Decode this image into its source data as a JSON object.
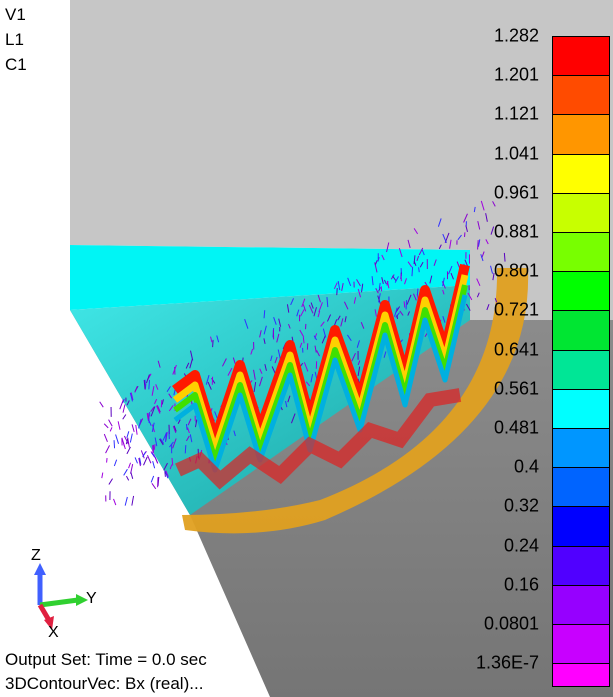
{
  "view_labels": [
    "V1",
    "L1",
    "C1"
  ],
  "legend": {
    "entries": [
      {
        "label": "1.282",
        "color": "#ff0000"
      },
      {
        "label": "1.201",
        "color": "#ff4b00"
      },
      {
        "label": "1.121",
        "color": "#ff9600"
      },
      {
        "label": "1.041",
        "color": "#ffff00"
      },
      {
        "label": "0.961",
        "color": "#c8ff00"
      },
      {
        "label": "0.881",
        "color": "#78ff00"
      },
      {
        "label": "0.801",
        "color": "#00ff00"
      },
      {
        "label": "0.721",
        "color": "#00e632"
      },
      {
        "label": "0.641",
        "color": "#00e696"
      },
      {
        "label": "0.561",
        "color": "#00ffff"
      },
      {
        "label": "0.481",
        "color": "#0096ff"
      },
      {
        "label": "0.4",
        "color": "#0064ff"
      },
      {
        "label": "0.32",
        "color": "#0000ff"
      },
      {
        "label": "0.24",
        "color": "#5000ff"
      },
      {
        "label": "0.16",
        "color": "#9600ff"
      },
      {
        "label": "0.0801",
        "color": "#c800ff"
      },
      {
        "label": "1.36E-7",
        "color": "#ff00ff"
      }
    ]
  },
  "triad": {
    "z": "Z",
    "y": "Y",
    "x": "X"
  },
  "status": {
    "output_set": "Output Set: Time = 0.0 sec",
    "contour": "3DContourVec: Bx (real)..."
  },
  "colors": {
    "background_top": "#c0c0c0",
    "background_bottom": "#808080",
    "plane": "#00ffff",
    "ring": "#e0a020"
  }
}
